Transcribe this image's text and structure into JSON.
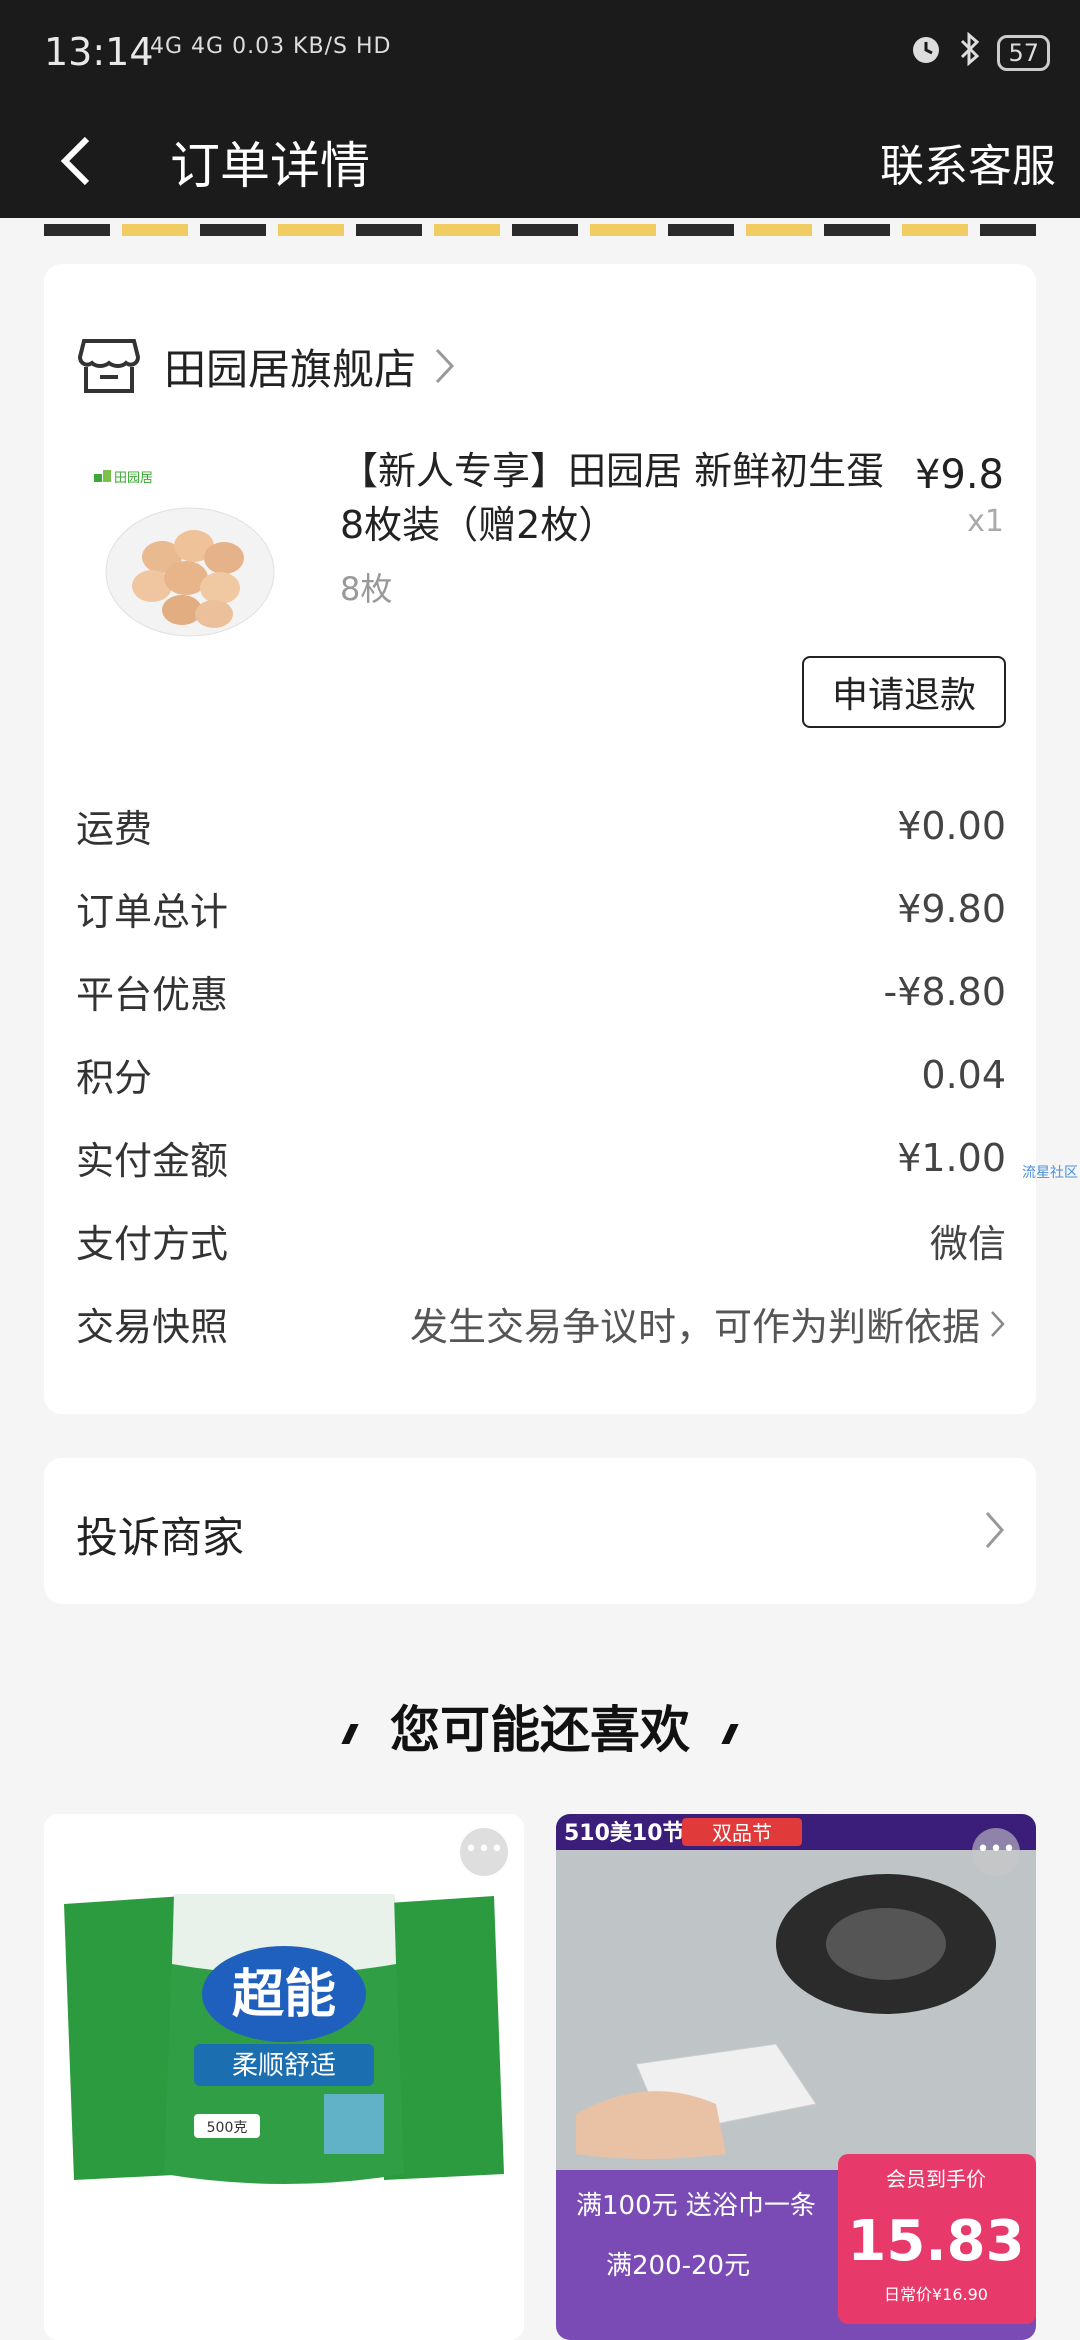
{
  "status_bar": {
    "time": "13:14",
    "network": "4G 4G 0.03 KB/S HD",
    "battery": "57"
  },
  "nav": {
    "title": "订单详情",
    "service": "联系客服"
  },
  "order": {
    "shop_name": "田园居旗舰店",
    "product": {
      "title": "【新人专享】田园居 新鲜初生蛋 8枚装（赠2枚）",
      "spec": "8枚",
      "price": "¥9.8",
      "qty": "x1",
      "brand_logo": "田园居"
    },
    "refund_label": "申请退款",
    "summary": [
      {
        "label": "运费",
        "value": "¥0.00"
      },
      {
        "label": "订单总计",
        "value": "¥9.80"
      },
      {
        "label": "平台优惠",
        "value": "-¥8.80"
      },
      {
        "label": "积分",
        "value": "0.04"
      },
      {
        "label": "实付金额",
        "value": "¥1.00"
      },
      {
        "label": "支付方式",
        "value": "微信"
      },
      {
        "label": "交易快照",
        "value": "发生交易争议时，可作为判断依据"
      }
    ]
  },
  "complaint": {
    "label": "投诉商家"
  },
  "recommend": {
    "title": "您可能还喜欢",
    "side_text": "流星社区",
    "left": {
      "brand": "超能",
      "subtitle": "柔顺舒适",
      "net": "500克"
    },
    "right": {
      "tag1": "510美10节",
      "tag2": "双品节",
      "promo1": "满100元 送浴巾一条",
      "promo2": "满200-20元",
      "member_label": "会员到手价",
      "price": "15.83",
      "normal_price": "日常价¥16.90"
    }
  }
}
